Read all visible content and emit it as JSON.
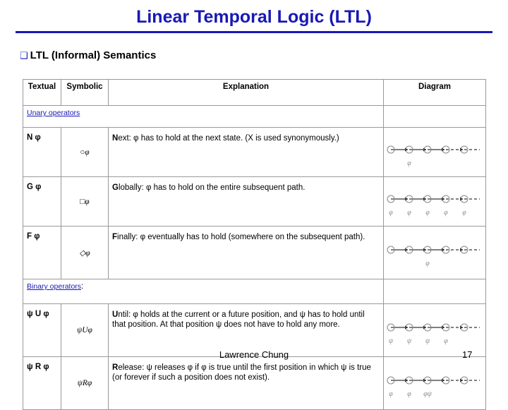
{
  "slide": {
    "title": "Linear Temporal Logic (LTL)",
    "heading": "LTL (Informal) Semantics",
    "bullet_mark": "❑",
    "footer_author": "Lawrence Chung",
    "page_number": "17",
    "accent_color": "#1818b5"
  },
  "table": {
    "headers": {
      "textual": "Textual",
      "symbolic": "Symbolic",
      "explanation": "Explanation",
      "diagram": "Diagram"
    },
    "sections": [
      {
        "label": "Unary operators",
        "suffix": ":"
      },
      {
        "label": "Binary operators",
        "suffix": ":"
      }
    ],
    "rows": [
      {
        "textual": "N φ",
        "symbolic": "○φ",
        "explanation_prefix": "N",
        "explanation": "ext: φ has to hold at the next state. (X is used synonymously.)",
        "diagram_states": 5,
        "diagram_marks": [
          "",
          "φ",
          "",
          "",
          ""
        ]
      },
      {
        "textual": "G φ",
        "symbolic": "□φ",
        "explanation_prefix": "G",
        "explanation": "lobally: φ has to hold on the entire subsequent path.",
        "diagram_states": 5,
        "diagram_marks": [
          "φ",
          "φ",
          "φ",
          "φ",
          "φ"
        ]
      },
      {
        "textual": "F φ",
        "symbolic": "◇φ",
        "explanation_prefix": "F",
        "explanation": "inally: φ eventually has to hold (somewhere on the subsequent path).",
        "diagram_states": 5,
        "diagram_marks": [
          "",
          "",
          "φ",
          "",
          ""
        ]
      },
      {
        "textual": "ψ U φ",
        "symbolic": "ψUφ",
        "explanation_prefix": "U",
        "explanation": "ntil: φ holds at the current or a future position, and ψ has to hold until that position. At that position ψ does not have to hold any more.",
        "diagram_states": 5,
        "diagram_marks": [
          "ψ",
          "ψ",
          "ψ",
          "φ",
          ""
        ]
      },
      {
        "textual": "ψ R φ",
        "symbolic": "ψRφ",
        "explanation_prefix": "R",
        "explanation": "elease: ψ releases φ if φ is true until the first position in which ψ is true (or forever if such a position does not exist).",
        "diagram_states": 5,
        "diagram_marks": [
          "φ",
          "φ",
          "φψ",
          "",
          ""
        ]
      }
    ]
  }
}
